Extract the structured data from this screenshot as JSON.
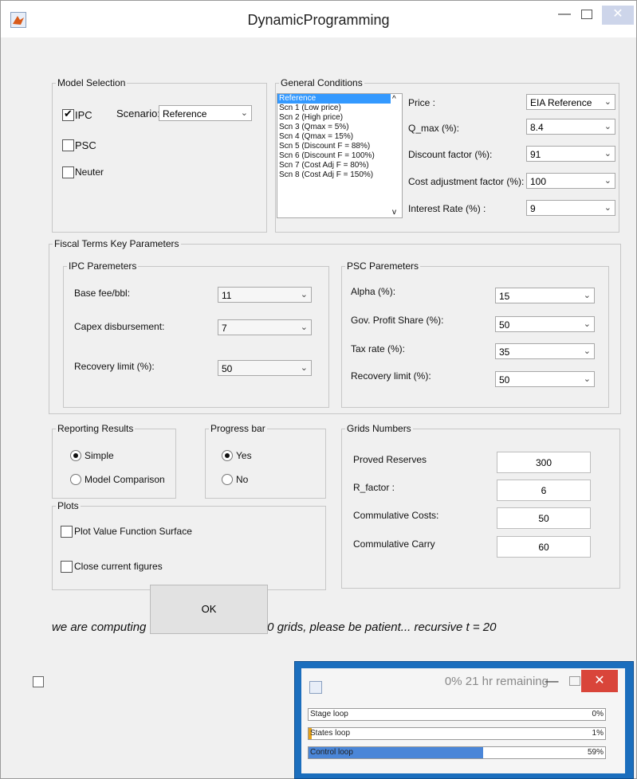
{
  "window": {
    "title": "DynamicProgramming"
  },
  "model_selection": {
    "label": "Model Selection",
    "ipc_label": "IPC",
    "ipc_checked": true,
    "scenario_label": "Scenario:",
    "scenario_value": "Reference",
    "psc_label": "PSC",
    "psc_checked": false,
    "neuter_label": "Neuter",
    "neuter_checked": false
  },
  "general_conditions": {
    "label": "General Conditions",
    "scenarios": [
      "Reference",
      "Scn 1 (Low price)",
      "Scn 2 (High price)",
      "Scn 3 (Qmax  = 5%)",
      "Scn 4 (Qmax = 15%)",
      "Scn 5 (Discount F = 88%)",
      "Scn 6 (Discount F = 100%)",
      "Scn 7 (Cost Adj F = 80%)",
      "Scn 8 (Cost Adj F = 150%)"
    ],
    "selected_index": 0,
    "price_label": "Price :",
    "price_value": "EIA Reference",
    "qmax_label": "Q_max  (%):",
    "qmax_value": "8.4",
    "discount_label": "Discount factor (%):",
    "discount_value": "91",
    "cost_adj_label": "Cost adjustment factor (%):",
    "cost_adj_value": "100",
    "interest_label": "Interest Rate (%) :",
    "interest_value": "9"
  },
  "fiscal_terms": {
    "label": "Fiscal Terms Key Parameters",
    "ipc": {
      "label": "IPC Paremeters",
      "base_fee_label": "Base fee/bbl:",
      "base_fee_value": "11",
      "capex_label": "Capex disbursement:",
      "capex_value": "7",
      "recovery_label": "Recovery limit (%):",
      "recovery_value": "50"
    },
    "psc": {
      "label": "PSC Paremeters",
      "alpha_label": "Alpha (%):",
      "alpha_value": "15",
      "gov_label": "Gov. Profit Share (%):",
      "gov_value": "50",
      "tax_label": "Tax rate (%):",
      "tax_value": "35",
      "recovery_label": "Recovery limit (%):",
      "recovery_value": "50"
    }
  },
  "reporting": {
    "label": "Reporting Results",
    "simple_label": "Simple",
    "comparison_label": "Model Comparison",
    "selected": "Simple"
  },
  "progress_bar_group": {
    "label": "Progress bar",
    "yes_label": "Yes",
    "no_label": "No",
    "selected": "Yes"
  },
  "plots": {
    "label": "Plots",
    "surface_label": "Plot Value Function Surface",
    "close_label": "Close current figures"
  },
  "grids": {
    "label": "Grids Numbers",
    "proved_label": "Proved Reserves",
    "proved_value": "300",
    "rfactor_label": "R_factor :",
    "rfactor_value": "6",
    "costs_label": "Commulative Costs:",
    "costs_value": "50",
    "carry_label": "Commulative Carry",
    "carry_value": "60"
  },
  "status_text": "we are computing v and q* for 108000000 grids, please be patient... recursive t = 20",
  "ok_label": "OK",
  "progress_window": {
    "title": "0%   21 hr remaining",
    "bars": [
      {
        "label": "Stage loop",
        "percent_text": "0%",
        "fraction": 0.0,
        "color": "#e6a21a"
      },
      {
        "label": "States loop",
        "percent_text": "1%",
        "fraction": 0.01,
        "color": "#e6a21a"
      },
      {
        "label": "Control loop",
        "percent_text": "59%",
        "fraction": 0.59,
        "color": "#4a86d8"
      }
    ]
  }
}
